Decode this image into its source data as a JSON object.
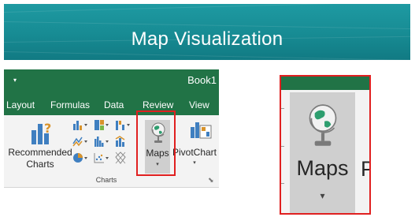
{
  "banner": {
    "title": "Map Visualization"
  },
  "ribbon": {
    "qat_icon": "quick-access-dropdown-icon",
    "doc_title": "Book1",
    "tabs": [
      {
        "label": "Layout"
      },
      {
        "label": "Formulas"
      },
      {
        "label": "Data"
      },
      {
        "label": "Review"
      },
      {
        "label": "View"
      }
    ],
    "recommended_charts": {
      "line1": "Recommended",
      "line2": "Charts",
      "icon": "recommended-charts-icon"
    },
    "maps": {
      "label": "Maps",
      "icon": "globe-icon",
      "dropdown": "▾"
    },
    "pivotchart": {
      "label": "PivotChart",
      "icon": "pivotchart-icon",
      "dropdown": "▾"
    },
    "group_label": "Charts",
    "launcher_icon": "dialog-launcher-icon"
  },
  "zoom": {
    "maps_label": "Maps",
    "next_label": "P",
    "dropdown": "▾"
  },
  "colors": {
    "banner": "#178b93",
    "ribbon_green": "#217346",
    "highlight": "#e02020",
    "button_pressed": "#cfcfcf"
  }
}
